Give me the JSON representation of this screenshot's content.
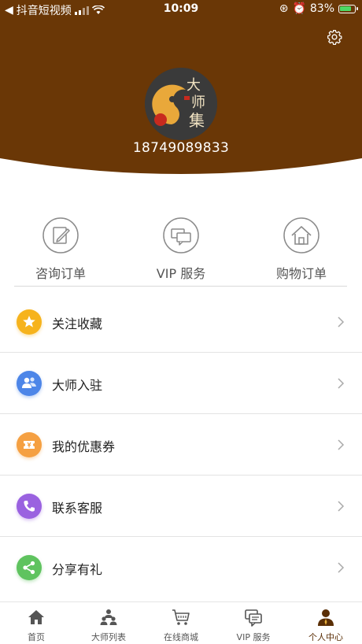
{
  "status_bar": {
    "carrier": "抖音短视频",
    "time": "10:09",
    "battery": "83%"
  },
  "profile": {
    "phone": "18749089833",
    "avatar_logo_text": "大师集"
  },
  "quick_actions": [
    {
      "label": "咨询订单",
      "icon": "edit-icon"
    },
    {
      "label": "VIP 服务",
      "icon": "chat-icon"
    },
    {
      "label": "购物订单",
      "icon": "home-icon"
    }
  ],
  "menu": [
    {
      "label": "关注收藏",
      "icon": "star-icon",
      "color": "#f6b31d"
    },
    {
      "label": "大师入驻",
      "icon": "users-icon",
      "color": "#4d86e8"
    },
    {
      "label": "我的优惠券",
      "icon": "ticket-icon",
      "color": "#f5a042"
    },
    {
      "label": "联系客服",
      "icon": "phone-icon",
      "color": "#9a62e0"
    },
    {
      "label": "分享有礼",
      "icon": "share-icon",
      "color": "#5fc35f"
    }
  ],
  "tabs": [
    {
      "label": "首页",
      "icon": "home-icon",
      "active": false
    },
    {
      "label": "大师列表",
      "icon": "group-icon",
      "active": false
    },
    {
      "label": "在线商城",
      "icon": "cart-icon",
      "active": false
    },
    {
      "label": "VIP 服务",
      "icon": "chat-icon",
      "active": false
    },
    {
      "label": "个人中心",
      "icon": "person-icon",
      "active": true
    }
  ],
  "colors": {
    "header_brown": "#6a3706",
    "active_tab": "#5a2e05"
  }
}
